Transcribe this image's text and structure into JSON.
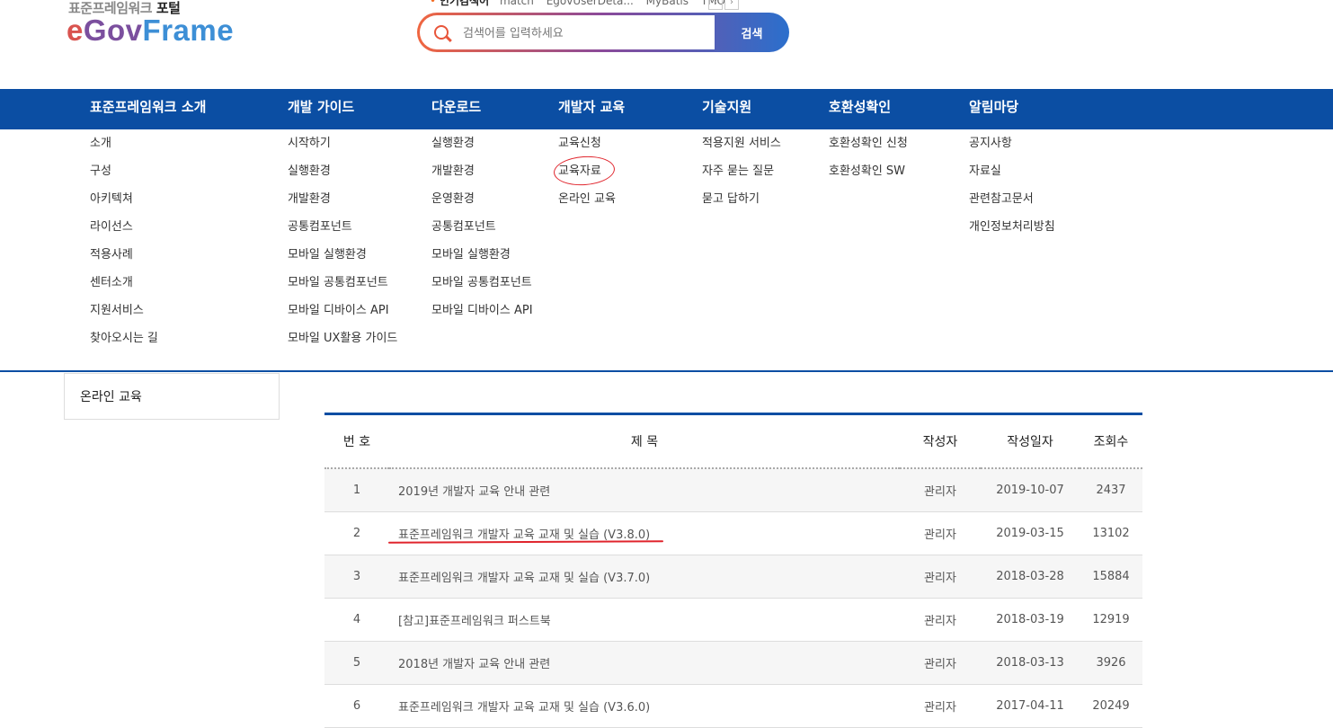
{
  "header": {
    "logo_sub_prefix": "표준프레임워크",
    "logo_sub_suffix": "포털",
    "logo_e": "e",
    "logo_gov": "Gov",
    "logo_frame": "Frame",
    "popular_label": "인기검색어",
    "popular_keywords": [
      "match",
      "EgovUserDeta...",
      "MyBatis",
      "TMO"
    ],
    "prev_icon": "‹",
    "next_icon": "›",
    "search_placeholder": "검색어를 입력하세요",
    "search_button": "검색"
  },
  "gnb": {
    "menus": [
      {
        "label": "표준프레임워크 소개",
        "items": [
          "소개",
          "구성",
          "아키텍쳐",
          "라이선스",
          "적용사례",
          "센터소개",
          "지원서비스",
          "찾아오시는 길"
        ]
      },
      {
        "label": "개발 가이드",
        "items": [
          "시작하기",
          "실행환경",
          "개발환경",
          "공통컴포넌트",
          "모바일 실행환경",
          "모바일 공통컴포넌트",
          "모바일 디바이스 API",
          "모바일 UX활용 가이드"
        ]
      },
      {
        "label": "다운로드",
        "items": [
          "실행환경",
          "개발환경",
          "운영환경",
          "공통컴포넌트",
          "모바일 실행환경",
          "모바일 공통컴포넌트",
          "모바일 디바이스 API"
        ]
      },
      {
        "label": "개발자 교육",
        "items": [
          "교육신청",
          "교육자료",
          "온라인 교육"
        ]
      },
      {
        "label": "기술지원",
        "items": [
          "적용지원 서비스",
          "자주 묻는 질문",
          "묻고 답하기"
        ]
      },
      {
        "label": "호환성확인",
        "items": [
          "호환성확인 신청",
          "호환성확인 SW"
        ]
      },
      {
        "label": "알림마당",
        "items": [
          "공지사항",
          "자료실",
          "관련참고문서",
          "개인정보처리방침"
        ]
      }
    ]
  },
  "lnb": {
    "title": "온라인 교육"
  },
  "board": {
    "headers": [
      "번 호",
      "제 목",
      "작성자",
      "작성일자",
      "조회수"
    ],
    "rows": [
      {
        "no": "1",
        "title": "2019년 개발자 교육 안내 관련",
        "author": "관리자",
        "date": "2019-10-07",
        "views": "2437"
      },
      {
        "no": "2",
        "title": "표준프레임워크 개발자 교육 교재 및 실습 (V3.8.0)",
        "author": "관리자",
        "date": "2019-03-15",
        "views": "13102"
      },
      {
        "no": "3",
        "title": "표준프레임워크 개발자 교육 교재 및 실습 (V3.7.0)",
        "author": "관리자",
        "date": "2018-03-28",
        "views": "15884"
      },
      {
        "no": "4",
        "title": "[참고]표준프레임워크 퍼스트북",
        "author": "관리자",
        "date": "2018-03-19",
        "views": "12919"
      },
      {
        "no": "5",
        "title": "2018년 개발자 교육 안내 관련",
        "author": "관리자",
        "date": "2018-03-13",
        "views": "3926"
      },
      {
        "no": "6",
        "title": "표준프레임워크 개발자 교육 교재 및 실습 (V3.6.0)",
        "author": "관리자",
        "date": "2017-04-11",
        "views": "20249"
      }
    ]
  },
  "annotations": {
    "mark_color": "#e0242c"
  }
}
